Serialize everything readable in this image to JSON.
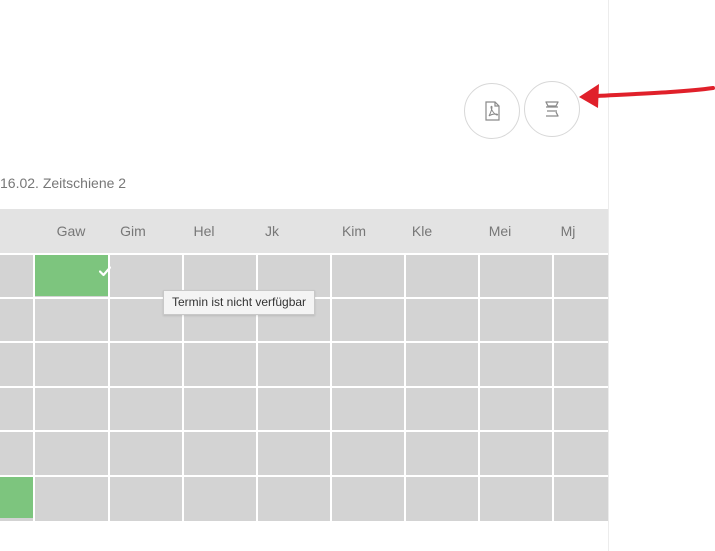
{
  "toolbar": {
    "pdf_icon": "pdf-icon",
    "list_icon": "list-icon"
  },
  "section": {
    "title": "16.02. Zeitschiene 2"
  },
  "table": {
    "columns": [
      "Gaw",
      "Gim",
      "Hel",
      "Jk",
      "Kim",
      "Kle",
      "Mei",
      "Mj"
    ],
    "green_cells": [
      {
        "row": 1,
        "col": "Gaw",
        "checked": true
      },
      {
        "row": 6,
        "col": "first-partial",
        "checked": false
      }
    ]
  },
  "tooltip": {
    "text": "Termin ist nicht verfügbar"
  },
  "colors": {
    "available": "#7dc57e",
    "unavailable": "#d3d3d3",
    "header": "#e3e3e3",
    "annotation_arrow": "#e0202a"
  }
}
